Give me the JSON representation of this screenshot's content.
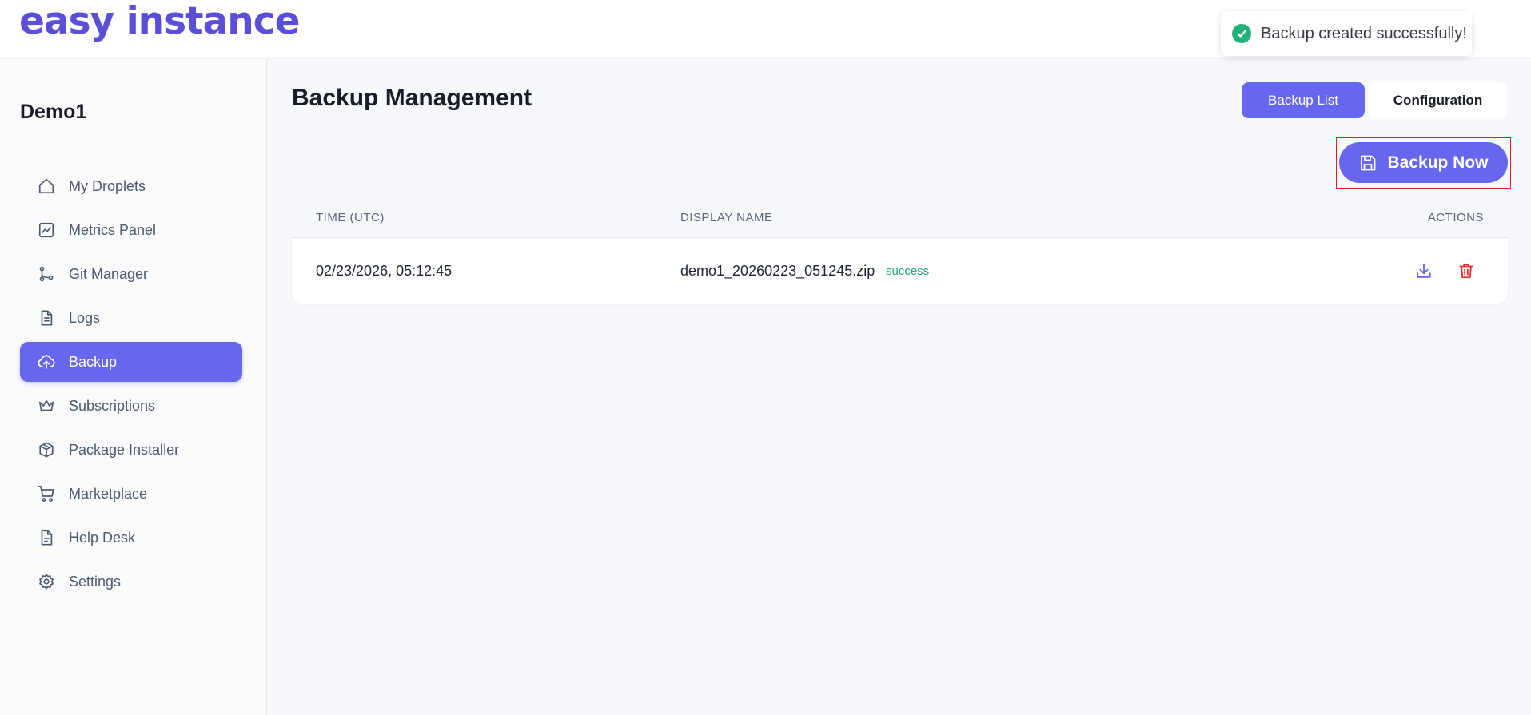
{
  "header": {
    "logo": "easy instance"
  },
  "toast": {
    "message": "Backup created successfully!"
  },
  "sidebar": {
    "project_name": "Demo1",
    "items": [
      {
        "label": "My Droplets",
        "icon": "home-icon",
        "active": false
      },
      {
        "label": "Metrics Panel",
        "icon": "chart-icon",
        "active": false
      },
      {
        "label": "Git Manager",
        "icon": "git-branch-icon",
        "active": false
      },
      {
        "label": "Logs",
        "icon": "file-text-icon",
        "active": false
      },
      {
        "label": "Backup",
        "icon": "cloud-upload-icon",
        "active": true
      },
      {
        "label": "Subscriptions",
        "icon": "crown-icon",
        "active": false
      },
      {
        "label": "Package Installer",
        "icon": "package-icon",
        "active": false
      },
      {
        "label": "Marketplace",
        "icon": "cart-icon",
        "active": false
      },
      {
        "label": "Help Desk",
        "icon": "document-icon",
        "active": false
      },
      {
        "label": "Settings",
        "icon": "gear-icon",
        "active": false
      }
    ]
  },
  "main": {
    "title": "Backup Management",
    "tabs": [
      {
        "label": "Backup List",
        "active": true
      },
      {
        "label": "Configuration",
        "active": false
      }
    ],
    "backup_button": "Backup Now",
    "table": {
      "headers": {
        "time": "TIME (UTC)",
        "name": "DISPLAY NAME",
        "actions": "ACTIONS"
      },
      "rows": [
        {
          "time": "02/23/2026, 05:12:45",
          "name": "demo1_20260223_051245.zip",
          "status": "success"
        }
      ]
    }
  },
  "colors": {
    "accent": "#6666ee",
    "logo": "#5b4fd8",
    "success": "#22b07d",
    "danger": "#e03131"
  }
}
